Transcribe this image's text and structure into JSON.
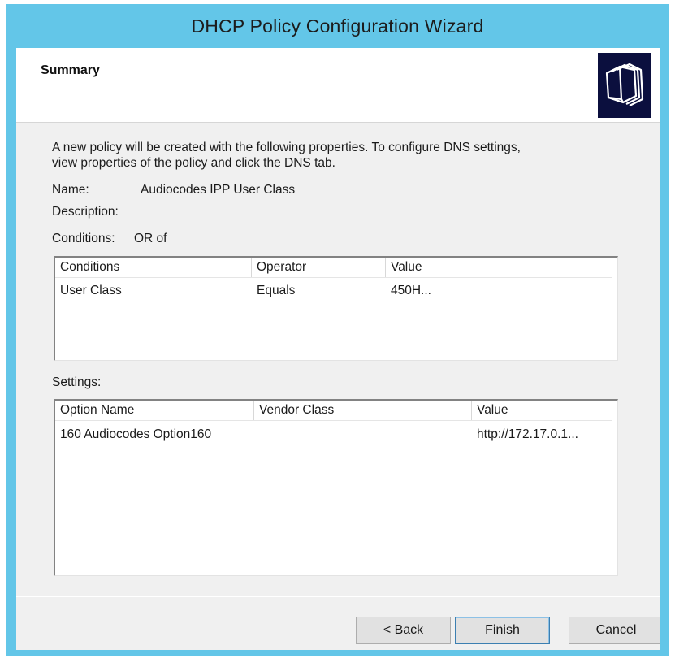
{
  "window": {
    "title": "DHCP Policy Configuration Wizard"
  },
  "header": {
    "title": "Summary",
    "icon": "wizard-documents-icon"
  },
  "summary": {
    "intro_line1": "A new policy will be created with the following properties. To configure DNS settings,",
    "intro_line2": "view properties of the policy and click the DNS tab.",
    "name_label": "Name:",
    "name_value": "Audiocodes IPP User Class",
    "description_label": "Description:",
    "description_value": "",
    "conditions_label": "Conditions:",
    "conditions_value": "OR of",
    "settings_label": "Settings:"
  },
  "conditions_table": {
    "columns": [
      "Conditions",
      "Operator",
      "Value"
    ],
    "rows": [
      [
        "User Class",
        "Equals",
        "450H..."
      ]
    ]
  },
  "settings_table": {
    "columns": [
      "Option Name",
      "Vendor Class",
      "Value"
    ],
    "rows": [
      [
        "160 Audiocodes Option160",
        "",
        "http://172.17.0.1..."
      ]
    ]
  },
  "buttons": {
    "back_mnemonic": "B",
    "back_rest": "ack",
    "back_prefix": "< ",
    "finish": "Finish",
    "cancel": "Cancel"
  },
  "colors": {
    "titlebar": "#63c6e8",
    "icon_background": "#0b0f3e"
  }
}
